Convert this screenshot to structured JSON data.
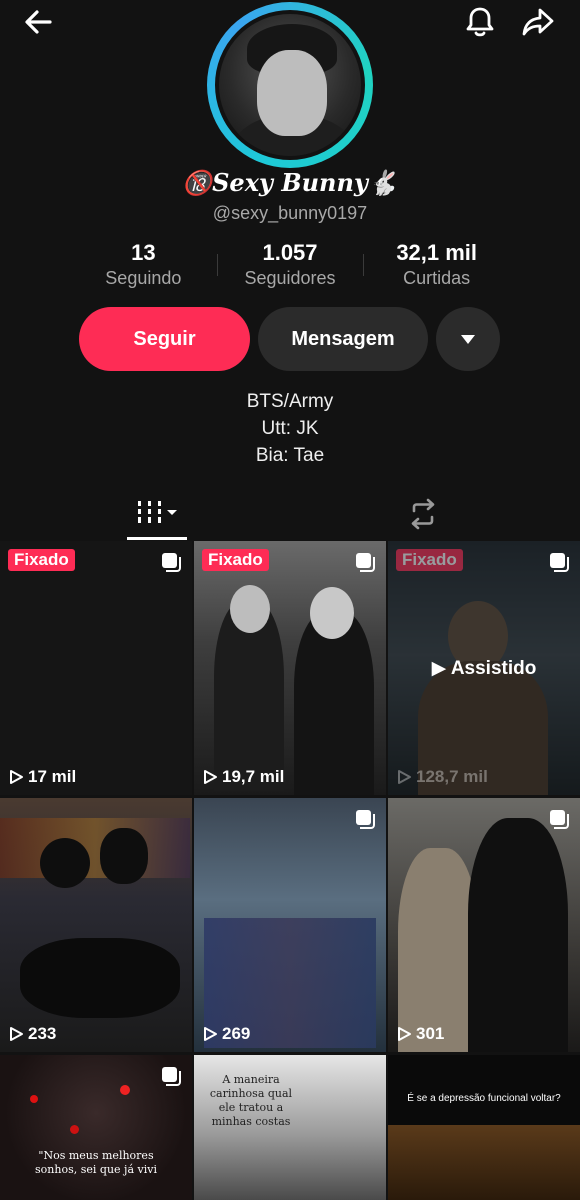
{
  "profile": {
    "display_name": "🔞Sexy Bunny🐇",
    "username": "@sexy_bunny0197"
  },
  "stats": [
    {
      "value": "13",
      "label": "Seguindo"
    },
    {
      "value": "1.057",
      "label": "Seguidores"
    },
    {
      "value": "32,1 mil",
      "label": "Curtidas"
    }
  ],
  "actions": {
    "follow_label": "Seguir",
    "message_label": "Mensagem"
  },
  "bio": [
    "BTS/Army",
    "Utt: JK",
    "Bia: Tae"
  ],
  "icons": {
    "back": "back-arrow-icon",
    "notification": "bell-icon",
    "share": "share-icon",
    "more": "chevron-down-icon",
    "videos_tab": "grid-icon",
    "repost_tab": "repost-icon"
  },
  "colors": {
    "accent": "#fe2c55",
    "background": "#121212",
    "avatar_ring": "#1ec9d8"
  },
  "videos": [
    {
      "pinned": "Fixado",
      "views": "17 mil",
      "multi": true,
      "watched": ""
    },
    {
      "pinned": "Fixado",
      "views": "19,7 mil",
      "multi": true,
      "watched": ""
    },
    {
      "pinned": "Fixado",
      "views": "128,7 mil",
      "multi": true,
      "watched": "Assistido"
    },
    {
      "pinned": "",
      "views": "233",
      "multi": false,
      "watched": ""
    },
    {
      "pinned": "",
      "views": "269",
      "multi": true,
      "watched": ""
    },
    {
      "pinned": "",
      "views": "301",
      "multi": true,
      "watched": ""
    },
    {
      "pinned": "",
      "views": "",
      "multi": true,
      "watched": "",
      "caption": "\"Nos meus melhores sonhos, sei que já vivi"
    },
    {
      "pinned": "",
      "views": "",
      "multi": false,
      "watched": "",
      "caption": "A maneira carinhosa qual ele tratou a minhas costas"
    },
    {
      "pinned": "",
      "views": "",
      "multi": false,
      "watched": "",
      "caption": "É se a depressão funcional voltar?"
    }
  ]
}
